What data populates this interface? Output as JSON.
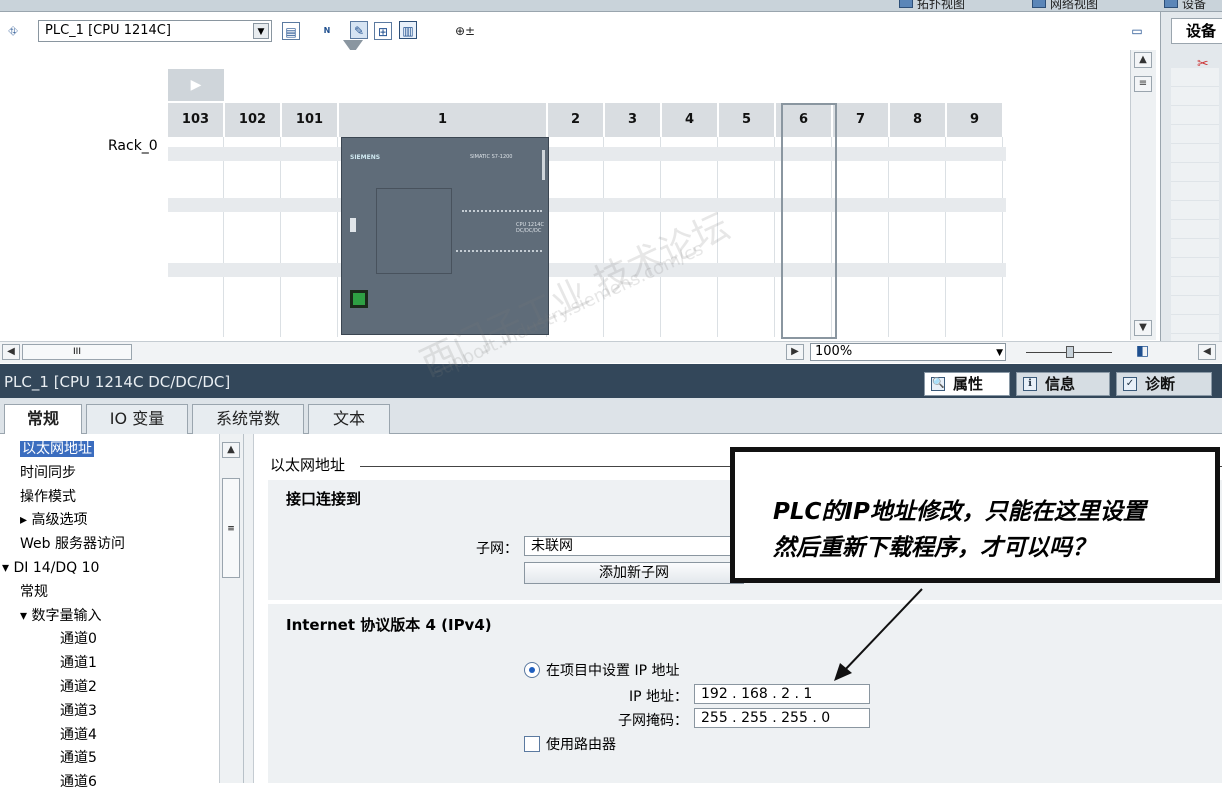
{
  "view_tabs": [
    "拓扑视图",
    "网络视图",
    "设备"
  ],
  "toolbar": {
    "device_select": "PLC_1 [CPU 1214C]",
    "zoom_icon": "⊕±"
  },
  "rack": {
    "label": "Rack_0",
    "slots": [
      "103",
      "102",
      "101",
      "1",
      "2",
      "3",
      "4",
      "5",
      "6",
      "7",
      "8",
      "9"
    ],
    "cpu_brand": "SIEMENS",
    "cpu_model": "SIMATIC S7-1200",
    "cpu_text": "CPU 1214C DC/DC/DC"
  },
  "right_panel": {
    "title": "设备"
  },
  "zoom": {
    "value": "100%"
  },
  "properties": {
    "title": "PLC_1 [CPU 1214C DC/DC/DC]",
    "tabs": [
      "属性",
      "信息",
      "诊断"
    ]
  },
  "subtabs": [
    "常规",
    "IO 变量",
    "系统常数",
    "文本"
  ],
  "tree": [
    {
      "label": "以太网地址",
      "indent": 0,
      "selected": true
    },
    {
      "label": "时间同步",
      "indent": 0
    },
    {
      "label": "操作模式",
      "indent": 0
    },
    {
      "label": "▸ 高级选项",
      "indent": 0
    },
    {
      "label": "Web 服务器访问",
      "indent": 0
    },
    {
      "label": "▾ DI 14/DQ 10",
      "indent": -1
    },
    {
      "label": "常规",
      "indent": 0
    },
    {
      "label": "▾ 数字量输入",
      "indent": 0
    },
    {
      "label": "通道0",
      "indent": 1
    },
    {
      "label": "通道1",
      "indent": 1
    },
    {
      "label": "通道2",
      "indent": 1
    },
    {
      "label": "通道3",
      "indent": 1
    },
    {
      "label": "通道4",
      "indent": 1
    },
    {
      "label": "通道5",
      "indent": 1
    },
    {
      "label": "通道6",
      "indent": 1
    }
  ],
  "content": {
    "section_title": "以太网地址",
    "iface_heading": "接口连接到",
    "subnet_label": "子网：",
    "subnet_value": "未联网",
    "add_subnet": "添加新子网",
    "ipv4_heading": "Internet 协议版本 4 (IPv4)",
    "radio_label": "在项目中设置 IP 地址",
    "ip_label": "IP 地址：",
    "ip_value": "192 . 168 . 2    . 1",
    "mask_label": "子网掩码：",
    "mask_value": "255 . 255 . 255 . 0",
    "router_label": "使用路由器"
  },
  "annotation": {
    "line1": "PLC的IP地址修改，只能在这里设置",
    "line2": "然后重新下载程序，才可以吗？"
  },
  "watermark": {
    "text1": "西门子工业 技术论坛",
    "text2": "support.industry.siemens.com/cs"
  }
}
